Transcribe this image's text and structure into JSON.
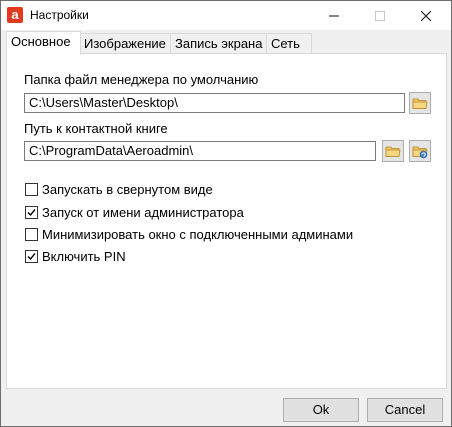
{
  "window": {
    "title": "Настройки",
    "app_icon_letter": "a"
  },
  "tabs": [
    {
      "label": "Основное"
    },
    {
      "label": "Изображение"
    },
    {
      "label": "Запись экрана"
    },
    {
      "label": "Сеть"
    }
  ],
  "general": {
    "fm_label": "Папка файл менеджера по умолчанию",
    "fm_path": "C:\\Users\\Master\\Desktop\\",
    "contacts_label": "Путь к контактной книге",
    "contacts_path": "C:\\ProgramData\\Aeroadmin\\",
    "options": [
      {
        "label": "Запускать в свернутом виде",
        "checked": false
      },
      {
        "label": "Запуск от имени администратора",
        "checked": true
      },
      {
        "label": "Минимизировать окно с подключенными админами",
        "checked": false
      },
      {
        "label": "Включить PIN",
        "checked": true
      }
    ]
  },
  "buttons": {
    "ok": "Ok",
    "cancel": "Cancel"
  },
  "colors": {
    "app_icon": "#e23a1e",
    "folder": "#e8b84a"
  }
}
